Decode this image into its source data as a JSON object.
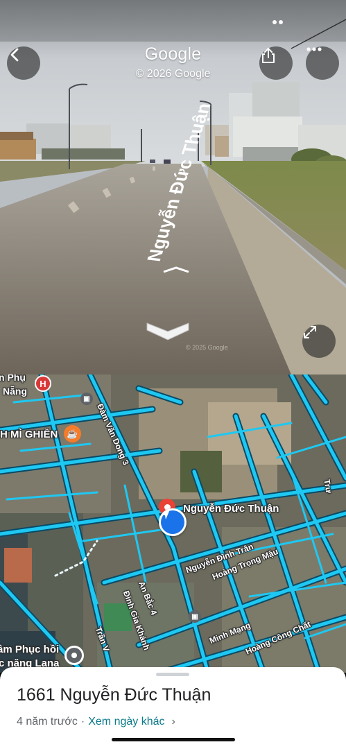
{
  "status_bar": {
    "indicator": "camera-in-use"
  },
  "street_view": {
    "brand": "Google",
    "copyright": "© 2026 Google",
    "road_label": "Nguyễn Đức Thuận",
    "image_watermark": "© 2025 Google",
    "buttons": {
      "back": "back",
      "share": "share",
      "more": "more",
      "expand": "expand"
    }
  },
  "map": {
    "labels": {
      "hospital_top": "n Phụ",
      "hospital_bottom": "Nẵng",
      "cafe": "H MÌ GHIỀN",
      "road_dam_van_dong": "Đàm Văn Dong 3",
      "selected_street": "Nguyễn Đức Thuận",
      "nguyen_dinh_tran": "Nguyễn Đình Trân",
      "hoang_trong_mau": "Hoàng Trọng Mậu",
      "an_bac": "An Bắc 4",
      "dinh_gia_khanh": "Đinh Gia Khánh",
      "minh_mang": "Minh Mạng",
      "hoang_cong_chat": "Hoàng Công Chất",
      "tran_v": "Trần V",
      "rehab_top": "âm Phục hồi",
      "rehab_bottom": "c năng Lana",
      "right_edge": "Trư"
    },
    "colors": {
      "road": "#1ec8f2",
      "road_outline": "#0a4a66",
      "pin": "#ea4335",
      "location": "#1a73e8",
      "cafe": "#f57c2a"
    }
  },
  "sheet": {
    "title": "1661 Nguyễn Đức Thuận",
    "age": "4 năm trước",
    "separator": "·",
    "other_dates": "Xem ngày khác",
    "chevron": "›"
  }
}
